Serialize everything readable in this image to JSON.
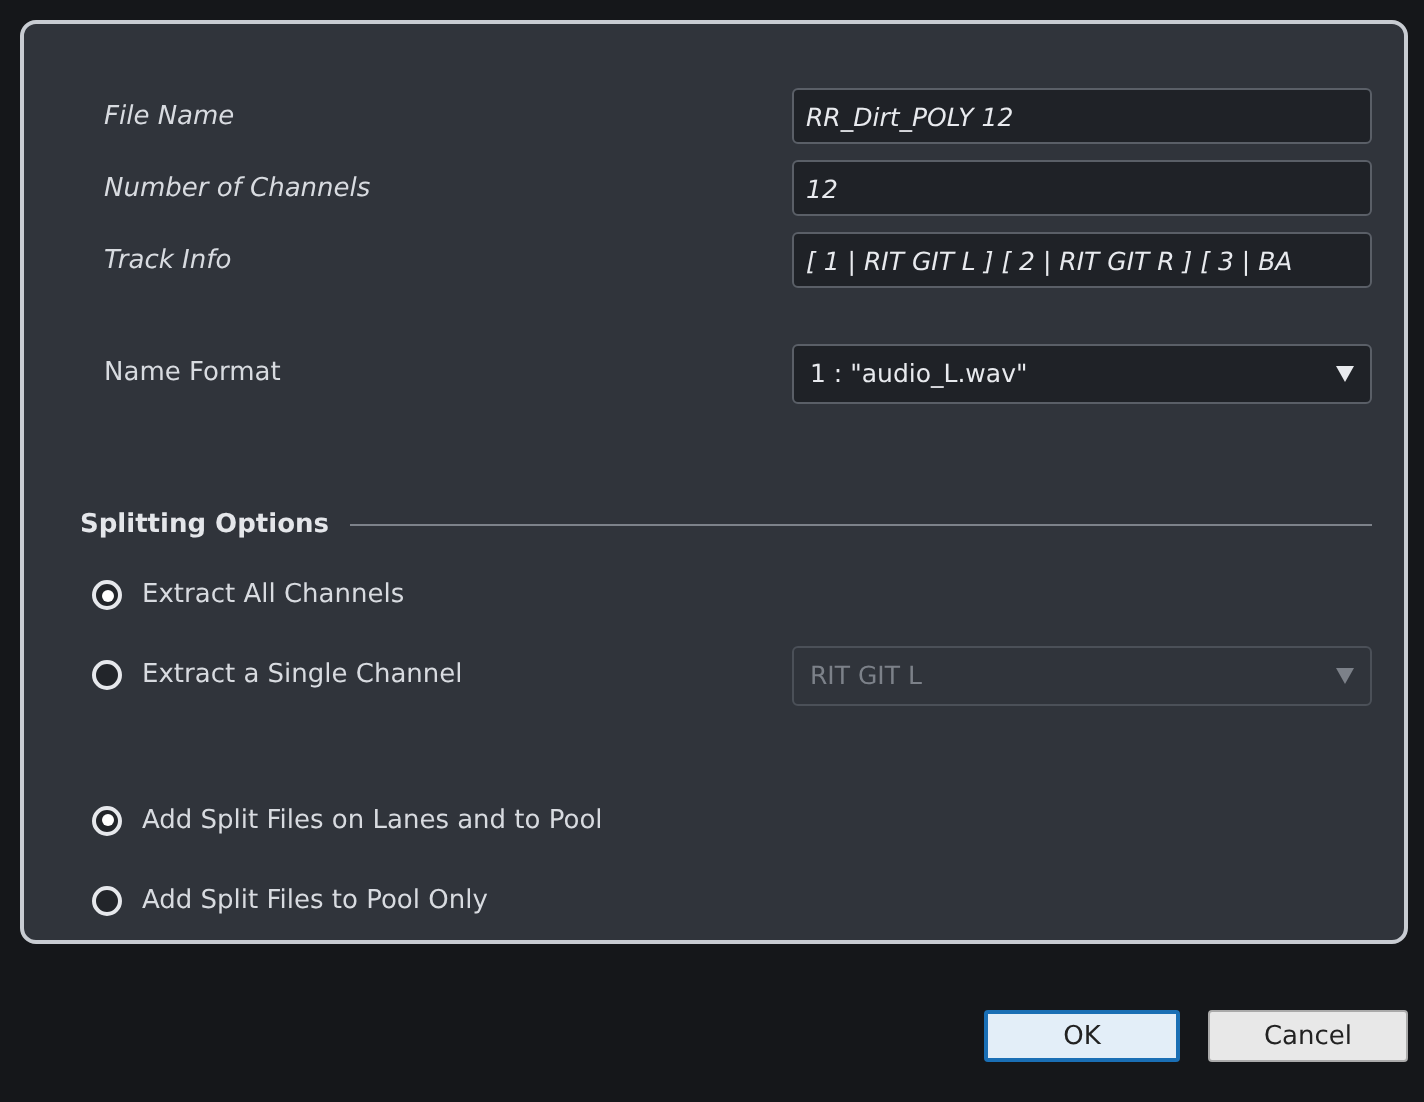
{
  "fields": [
    {
      "label": "File Name",
      "value": "RR_Dirt_POLY 12"
    },
    {
      "label": "Number of Channels",
      "value": "12"
    },
    {
      "label": "Track Info",
      "value": "[ 1 | RIT GIT L ]  [ 2 | RIT GIT R ]  [ 3 | BA"
    }
  ],
  "name_format": {
    "label": "Name Format",
    "value": "1 : \"audio_L.wav\"",
    "disabled": false
  },
  "splitting": {
    "title": "Splitting Options",
    "extract_options": [
      {
        "label": "Extract All Channels",
        "selected": true
      },
      {
        "label": "Extract a Single Channel",
        "selected": false
      }
    ],
    "channel_dropdown": {
      "value": "RIT GIT L",
      "disabled": true
    },
    "add_options": [
      {
        "label": "Add Split Files on Lanes and to Pool",
        "selected": true
      },
      {
        "label": "Add Split Files to Pool Only",
        "selected": false
      }
    ]
  },
  "buttons": [
    {
      "label": "OK",
      "focused": true
    },
    {
      "label": "Cancel",
      "focused": false
    }
  ]
}
